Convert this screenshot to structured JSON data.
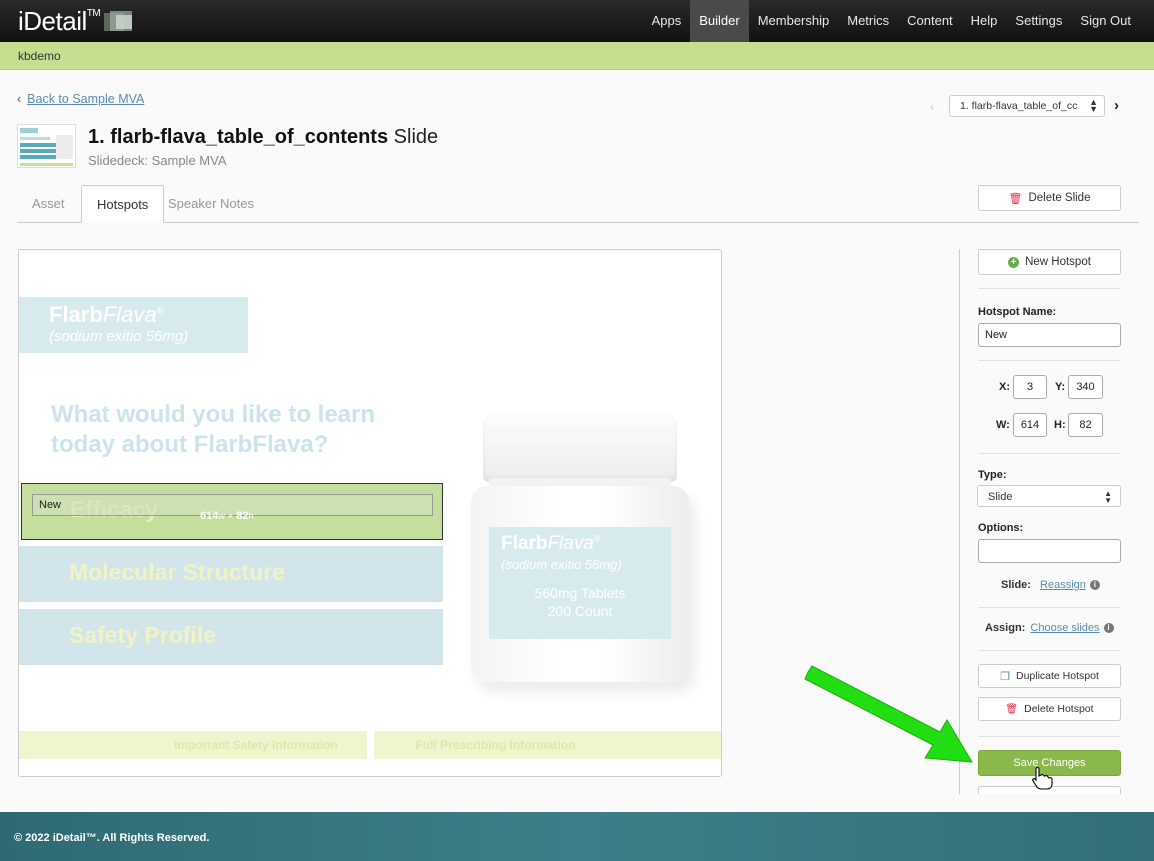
{
  "app": {
    "logo": "iDetail",
    "logo_tm": "TM"
  },
  "nav": [
    "Apps",
    "Builder",
    "Membership",
    "Metrics",
    "Content",
    "Help",
    "Settings",
    "Sign Out"
  ],
  "nav_active": "Builder",
  "account": "kbdemo",
  "back_link": "Back to Sample MVA",
  "slide_select": {
    "value": "1. flarb-flava_table_of_cc"
  },
  "slide": {
    "title": "1. flarb-flava_table_of_contents",
    "kind": "Slide",
    "slidedeck": "Slidedeck: Sample MVA"
  },
  "tabs": [
    "Asset",
    "Hotspots",
    "Speaker Notes"
  ],
  "tab_active": "Hotspots",
  "delete_slide": "Delete Slide",
  "canvas": {
    "brand": {
      "bold": "Flarb",
      "italic": "Flava",
      "reg": "®",
      "sub": "(sodium exitio 56mg)"
    },
    "question_line1": "What would you like to learn",
    "question_line2": "today about FlarbFlava?",
    "menu": [
      "Efficacy",
      "Molecular Structure",
      "Safety Profile"
    ],
    "hotspot": {
      "name": "New",
      "w": "614",
      "w_unit": "w",
      "x_sep": "×",
      "h": "82",
      "h_unit": "h"
    },
    "bottle": {
      "bold": "Flarb",
      "italic": "Flava",
      "reg": "®",
      "sub": "(sodium exitio 56mg)",
      "line1": "560mg Tablets",
      "line2": "200 Count"
    },
    "footer_left": "Important Safety Information",
    "footer_right": "Full Prescribing Information"
  },
  "panel": {
    "new_hotspot": "New Hotspot",
    "name_label": "Hotspot Name:",
    "name_value": "New",
    "x_label": "X:",
    "x": "3",
    "y_label": "Y:",
    "y": "340",
    "w_label": "W:",
    "w": "614",
    "h_label": "H:",
    "h": "82",
    "type_label": "Type:",
    "type_value": "Slide",
    "options_label": "Options:",
    "options_value": "",
    "slide_label": "Slide:",
    "slide_link": "Reassign",
    "assign_label": "Assign:",
    "assign_link": "Choose slides",
    "duplicate": "Duplicate Hotspot",
    "delete": "Delete Hotspot",
    "save": "Save Changes"
  },
  "footer": "© 2022 iDetail™.  All Rights Reserved.",
  "colors": {
    "accent_green": "#8ab84a",
    "subbar": "#c5de8f",
    "link": "#5b8bb5",
    "arrow": "#22dd11",
    "delete_red": "#d9304f"
  }
}
